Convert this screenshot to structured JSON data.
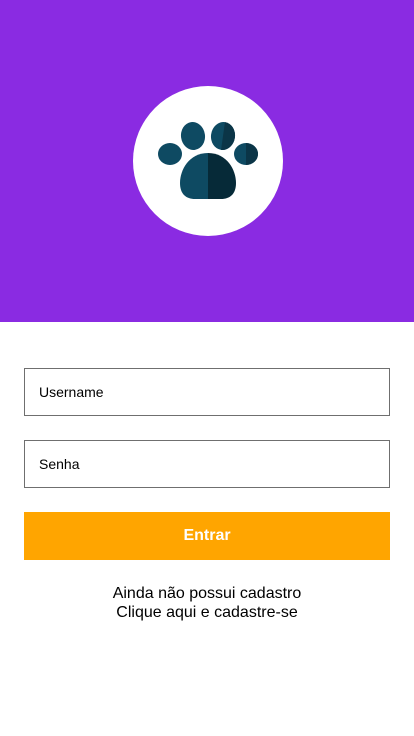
{
  "header": {
    "logo_icon": "paw-icon",
    "background_color": "#8a2be2"
  },
  "form": {
    "username_placeholder": "Username",
    "password_placeholder": "Senha",
    "submit_label": "Entrar",
    "submit_color": "#ffa500"
  },
  "signup": {
    "prompt": "Ainda não possui cadastro",
    "link_text": "Clique aqui e cadastre-se"
  }
}
